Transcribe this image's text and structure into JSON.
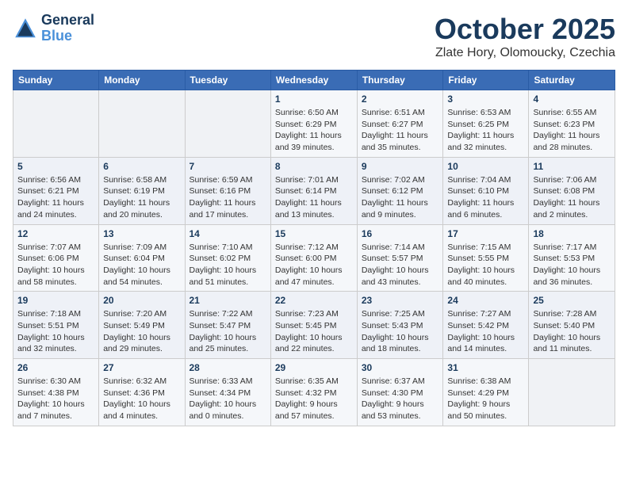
{
  "app": {
    "name": "GeneralBlue",
    "logo_text_line1": "General",
    "logo_text_line2": "Blue"
  },
  "header": {
    "month_title": "October 2025",
    "subtitle": "Zlate Hory, Olomoucky, Czechia"
  },
  "calendar": {
    "days_of_week": [
      "Sunday",
      "Monday",
      "Tuesday",
      "Wednesday",
      "Thursday",
      "Friday",
      "Saturday"
    ],
    "weeks": [
      [
        {
          "day": "",
          "info": ""
        },
        {
          "day": "",
          "info": ""
        },
        {
          "day": "",
          "info": ""
        },
        {
          "day": "1",
          "info": "Sunrise: 6:50 AM\nSunset: 6:29 PM\nDaylight: 11 hours\nand 39 minutes."
        },
        {
          "day": "2",
          "info": "Sunrise: 6:51 AM\nSunset: 6:27 PM\nDaylight: 11 hours\nand 35 minutes."
        },
        {
          "day": "3",
          "info": "Sunrise: 6:53 AM\nSunset: 6:25 PM\nDaylight: 11 hours\nand 32 minutes."
        },
        {
          "day": "4",
          "info": "Sunrise: 6:55 AM\nSunset: 6:23 PM\nDaylight: 11 hours\nand 28 minutes."
        }
      ],
      [
        {
          "day": "5",
          "info": "Sunrise: 6:56 AM\nSunset: 6:21 PM\nDaylight: 11 hours\nand 24 minutes."
        },
        {
          "day": "6",
          "info": "Sunrise: 6:58 AM\nSunset: 6:19 PM\nDaylight: 11 hours\nand 20 minutes."
        },
        {
          "day": "7",
          "info": "Sunrise: 6:59 AM\nSunset: 6:16 PM\nDaylight: 11 hours\nand 17 minutes."
        },
        {
          "day": "8",
          "info": "Sunrise: 7:01 AM\nSunset: 6:14 PM\nDaylight: 11 hours\nand 13 minutes."
        },
        {
          "day": "9",
          "info": "Sunrise: 7:02 AM\nSunset: 6:12 PM\nDaylight: 11 hours\nand 9 minutes."
        },
        {
          "day": "10",
          "info": "Sunrise: 7:04 AM\nSunset: 6:10 PM\nDaylight: 11 hours\nand 6 minutes."
        },
        {
          "day": "11",
          "info": "Sunrise: 7:06 AM\nSunset: 6:08 PM\nDaylight: 11 hours\nand 2 minutes."
        }
      ],
      [
        {
          "day": "12",
          "info": "Sunrise: 7:07 AM\nSunset: 6:06 PM\nDaylight: 10 hours\nand 58 minutes."
        },
        {
          "day": "13",
          "info": "Sunrise: 7:09 AM\nSunset: 6:04 PM\nDaylight: 10 hours\nand 54 minutes."
        },
        {
          "day": "14",
          "info": "Sunrise: 7:10 AM\nSunset: 6:02 PM\nDaylight: 10 hours\nand 51 minutes."
        },
        {
          "day": "15",
          "info": "Sunrise: 7:12 AM\nSunset: 6:00 PM\nDaylight: 10 hours\nand 47 minutes."
        },
        {
          "day": "16",
          "info": "Sunrise: 7:14 AM\nSunset: 5:57 PM\nDaylight: 10 hours\nand 43 minutes."
        },
        {
          "day": "17",
          "info": "Sunrise: 7:15 AM\nSunset: 5:55 PM\nDaylight: 10 hours\nand 40 minutes."
        },
        {
          "day": "18",
          "info": "Sunrise: 7:17 AM\nSunset: 5:53 PM\nDaylight: 10 hours\nand 36 minutes."
        }
      ],
      [
        {
          "day": "19",
          "info": "Sunrise: 7:18 AM\nSunset: 5:51 PM\nDaylight: 10 hours\nand 32 minutes."
        },
        {
          "day": "20",
          "info": "Sunrise: 7:20 AM\nSunset: 5:49 PM\nDaylight: 10 hours\nand 29 minutes."
        },
        {
          "day": "21",
          "info": "Sunrise: 7:22 AM\nSunset: 5:47 PM\nDaylight: 10 hours\nand 25 minutes."
        },
        {
          "day": "22",
          "info": "Sunrise: 7:23 AM\nSunset: 5:45 PM\nDaylight: 10 hours\nand 22 minutes."
        },
        {
          "day": "23",
          "info": "Sunrise: 7:25 AM\nSunset: 5:43 PM\nDaylight: 10 hours\nand 18 minutes."
        },
        {
          "day": "24",
          "info": "Sunrise: 7:27 AM\nSunset: 5:42 PM\nDaylight: 10 hours\nand 14 minutes."
        },
        {
          "day": "25",
          "info": "Sunrise: 7:28 AM\nSunset: 5:40 PM\nDaylight: 10 hours\nand 11 minutes."
        }
      ],
      [
        {
          "day": "26",
          "info": "Sunrise: 6:30 AM\nSunset: 4:38 PM\nDaylight: 10 hours\nand 7 minutes."
        },
        {
          "day": "27",
          "info": "Sunrise: 6:32 AM\nSunset: 4:36 PM\nDaylight: 10 hours\nand 4 minutes."
        },
        {
          "day": "28",
          "info": "Sunrise: 6:33 AM\nSunset: 4:34 PM\nDaylight: 10 hours\nand 0 minutes."
        },
        {
          "day": "29",
          "info": "Sunrise: 6:35 AM\nSunset: 4:32 PM\nDaylight: 9 hours\nand 57 minutes."
        },
        {
          "day": "30",
          "info": "Sunrise: 6:37 AM\nSunset: 4:30 PM\nDaylight: 9 hours\nand 53 minutes."
        },
        {
          "day": "31",
          "info": "Sunrise: 6:38 AM\nSunset: 4:29 PM\nDaylight: 9 hours\nand 50 minutes."
        },
        {
          "day": "",
          "info": ""
        }
      ]
    ]
  }
}
